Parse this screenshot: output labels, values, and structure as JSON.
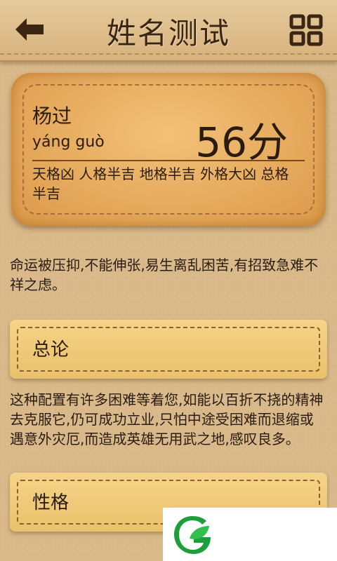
{
  "header": {
    "title": "姓名测试",
    "back_icon": "back-arrow-icon",
    "menu_icon": "grid-icon"
  },
  "result": {
    "name": "杨过",
    "pinyin": "yáng guò",
    "score": "56分",
    "grades": "天格凶 人格半吉 地格半吉 外格大凶 总格半吉"
  },
  "fortune": "命运被压抑,不能伸张,易生离乱困苦,有招致急难不祥之虑。",
  "sections": [
    {
      "label": "总论",
      "text": "这种配置有许多困难等着您,如能以百折不挠的精神去克服它,仍可成功立业,只怕中途受困难而退缩或遇意外灾厄,而造成英雄无用武之地,感叹良多。"
    },
    {
      "label": "性格"
    }
  ],
  "colors": {
    "leather": "#d9b98a",
    "card": "#e8ac5c",
    "section": "#f0c878",
    "text": "#2a1c10",
    "logo_green": "#1e9e3a"
  },
  "logo": "green-leaf-logo"
}
